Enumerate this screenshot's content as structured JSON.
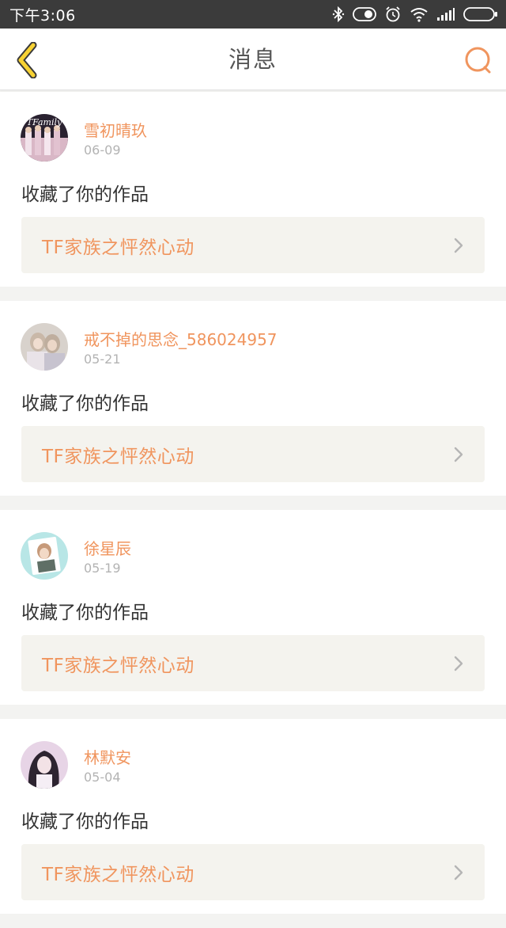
{
  "status_bar": {
    "time": "下午3:06"
  },
  "header": {
    "title": "消息",
    "back_icon": "chevron-left-icon",
    "chat_icon": "chat-bubble-icon"
  },
  "colors": {
    "accent": "#f0955e",
    "back_yellow": "#f7d233",
    "card_link_bg": "#f4f3ee"
  },
  "messages": [
    {
      "username": "雪初晴玖",
      "date": "06-09",
      "action": "收藏了你的作品",
      "work_title": "TF家族之怦然心动",
      "avatar_caption": "TFamily"
    },
    {
      "username": "戒不掉的思念_586024957",
      "date": "05-21",
      "action": "收藏了你的作品",
      "work_title": "TF家族之怦然心动"
    },
    {
      "username": "徐星辰",
      "date": "05-19",
      "action": "收藏了你的作品",
      "work_title": "TF家族之怦然心动"
    },
    {
      "username": "林默安",
      "date": "05-04",
      "action": "收藏了你的作品",
      "work_title": "TF家族之怦然心动"
    }
  ]
}
